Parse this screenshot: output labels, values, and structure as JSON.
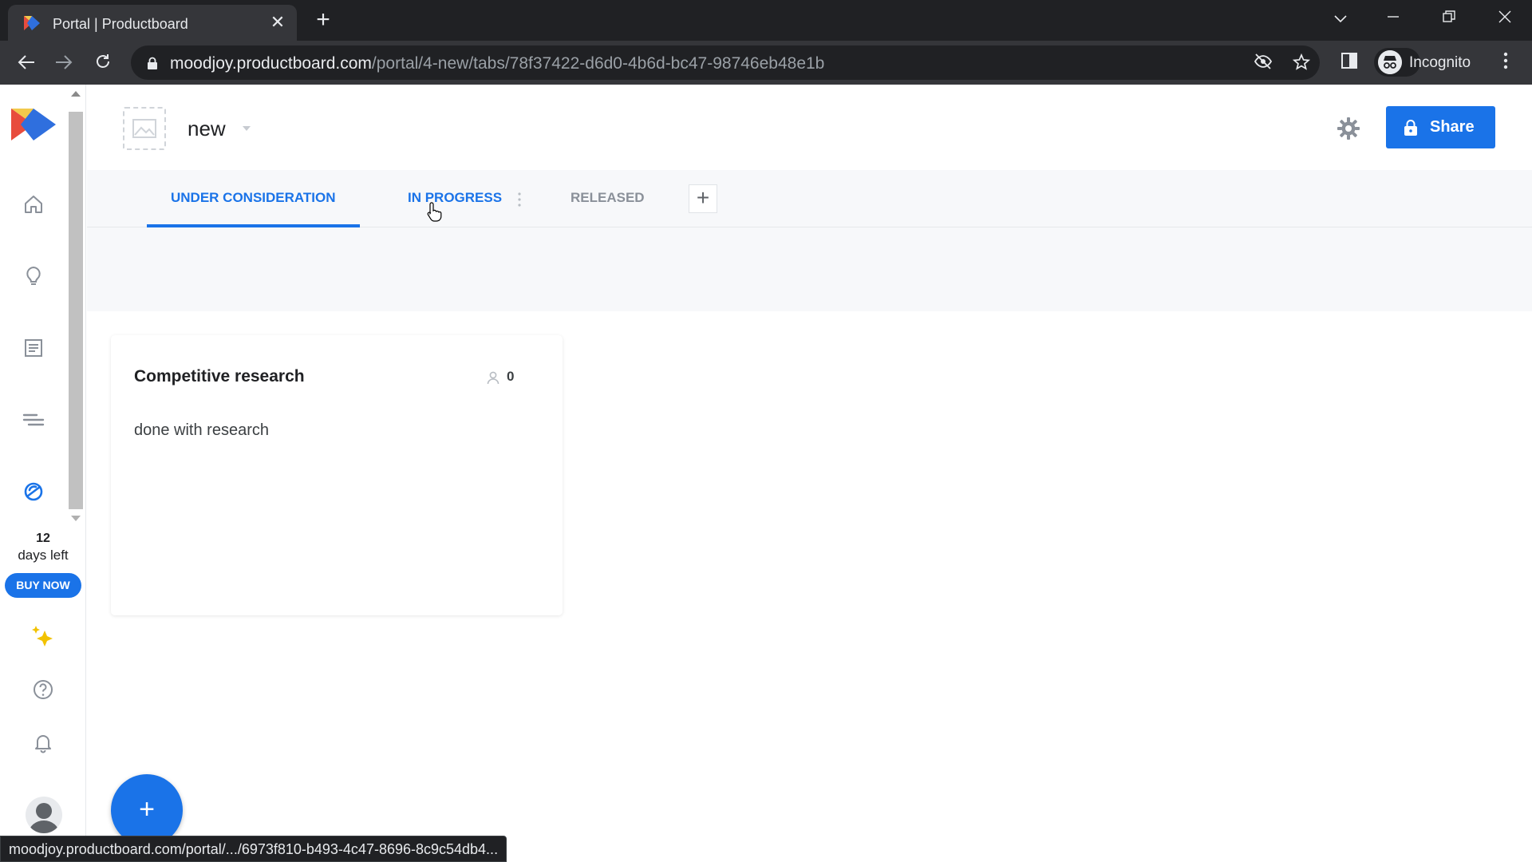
{
  "browser": {
    "tab_title": "Portal | Productboard",
    "tab_close": "✕",
    "new_tab": "+",
    "url_host": "moodjoy.productboard.com",
    "url_path": "/portal/4-new/tabs/78f37422-d6d0-4b6d-bc47-98746eb48e1b",
    "profile_label": "Incognito",
    "status_url": "moodjoy.productboard.com/portal/.../6973f810-b493-4c47-8696-8c9c54db4..."
  },
  "sidebar": {
    "trial_days": "12",
    "trial_label": "days left",
    "buy_now": "BUY NOW"
  },
  "portal": {
    "name": "new",
    "share_label": "Share",
    "tabs": [
      {
        "label": "UNDER CONSIDERATION",
        "active": true
      },
      {
        "label": "IN PROGRESS",
        "active": false
      },
      {
        "label": "RELEASED",
        "active": false
      }
    ],
    "add_tab": "+",
    "fab": "+"
  },
  "card": {
    "title": "Competitive research",
    "votes": "0",
    "description": "done with research"
  },
  "colors": {
    "accent": "#1a73e8",
    "tab_inactive": "#8a9099",
    "chrome_dark": "#202124"
  }
}
